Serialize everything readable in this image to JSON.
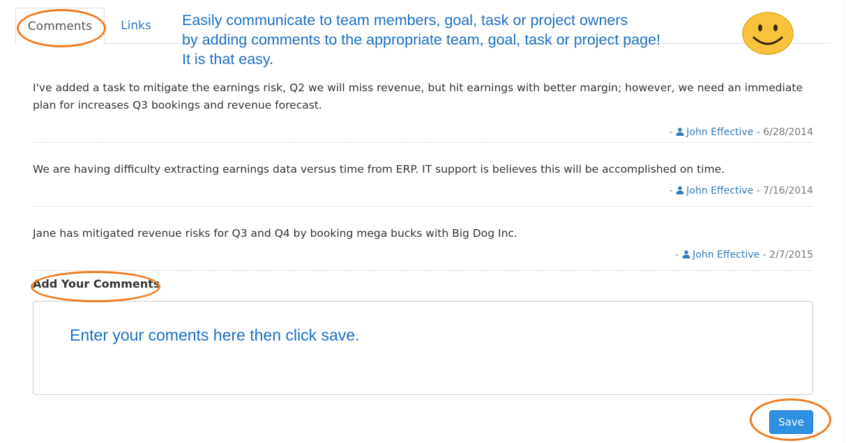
{
  "tabs": [
    {
      "label": "Comments",
      "active": true
    },
    {
      "label": "Links",
      "active": false
    }
  ],
  "hint_lines": [
    "Easily communicate to team members, goal, task or project owners",
    "by adding comments to the appropriate team, goal, task or project page!",
    "It is that easy."
  ],
  "comments": [
    {
      "text": "I've added a task to mitigate the earnings risk, Q2 we will miss revenue, but hit earnings with better margin; however, we need an immediate plan for increases Q3 bookings and revenue forecast.",
      "prefix": "- ",
      "author": "John Effective",
      "date": " - 6/28/2014"
    },
    {
      "text": "We are having difficulty extracting earnings data versus time from ERP. IT support is believes this will be accomplished on time.",
      "prefix": "- ",
      "author": "John Effective",
      "date": " - 7/16/2014"
    },
    {
      "text": "Jane has mitigated revenue risks for Q3 and Q4 by booking mega bucks with Big Dog Inc.",
      "prefix": "- ",
      "author": "John Effective",
      "date": " - 2/7/2015"
    }
  ],
  "add_comments_label": "Add Your Comments",
  "textarea_hint": "Enter your coments here then click save.",
  "save_label": "Save",
  "icons": {
    "smiley": "smiley-icon",
    "user": "user-icon"
  },
  "colors": {
    "accent": "#337ab7",
    "annotation": "#f07a1f",
    "hint": "#1b6fc4",
    "save_button": "#2f8fe0",
    "smiley": "#f8c23a"
  }
}
